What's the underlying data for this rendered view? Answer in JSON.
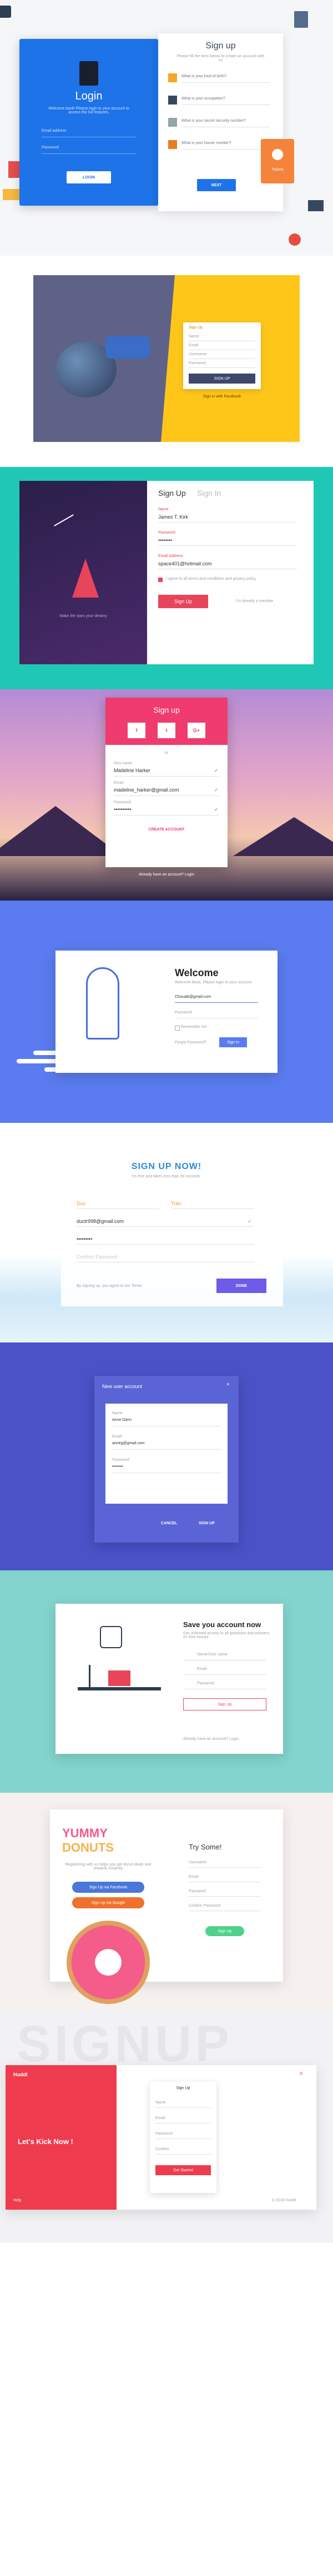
{
  "panel1": {
    "left_title": "Login",
    "left_desc": "Welcome back! Please login to your account to access the full features.",
    "email_placeholder": "Email address",
    "password_placeholder": "Password",
    "login_button": "LOGIN",
    "right_title": "Sign up",
    "right_desc": "Please fill the form below to create an account with us",
    "questions": [
      "What is your kind of birth?",
      "What is your occupation?",
      "What is your secret security number?",
      "What is your house number?"
    ],
    "next_button": "NEXT",
    "badge_text": "Tickets"
  },
  "panel2": {
    "card_title": "Sign Up",
    "fields": [
      "Name",
      "Email",
      "Username",
      "Password"
    ],
    "button": "SIGN UP",
    "footer": "Sign in with Facebook"
  },
  "panel3": {
    "left_text": "Make the stars your destiny",
    "tab_signup": "Sign Up",
    "tab_signin": "Sign In",
    "name_label": "Name",
    "name_value": "James T. Kirk",
    "password_label": "Password",
    "password_value": "••••••••",
    "email_label": "Email Address",
    "email_value": "space401@hotmail.com",
    "checkbox_text": "I agree to all terms and conditions and privacy policy",
    "button": "Sign Up",
    "link": "I'm already a member"
  },
  "panel4": {
    "title": "Sign up",
    "social": [
      "f",
      "t",
      "G+"
    ],
    "or_text": "or",
    "first_label": "First name",
    "first_value": "Madeline Harker",
    "email_label": "Email",
    "email_value": "madeline_harker@gmail.com",
    "password_label": "Password",
    "password_value": "••••••••••",
    "button": "CREATE ACCOUNT",
    "footer": "Already have an account? Login"
  },
  "panel5": {
    "title": "Welcome",
    "subtitle": "Welcome Back, Please login to your account",
    "email_value": "Chouaib@gmail.com",
    "password_placeholder": "Password",
    "remember": "Remember me",
    "forgot": "Forgot Password?",
    "button": "Sign In"
  },
  "panel6": {
    "title": "SIGN UP NOW!",
    "subtitle": "It's free and takes less than 30 seconds.",
    "first_name": "Duc",
    "last_name": "Tran",
    "email_value": "ductr998@gmail.com",
    "password_value": "•••••••••",
    "confirm_placeholder": "Confirm Password",
    "terms": "By signing up, you agree to our Terms",
    "button": "DONE"
  },
  "panel7": {
    "header": "New user account",
    "name_label": "Name",
    "name_value": "Anne Dann",
    "email_label": "Email",
    "email_value": "anneg@gmail.com",
    "password_label": "Password",
    "password_value": "••••••••",
    "cancel": "CANCEL",
    "signup": "SIGN UP"
  },
  "panel8": {
    "title": "Save you account now",
    "subtitle": "Get unlimited access to all questions and answers, it's free forever",
    "fields": [
      "Name/User name",
      "Email",
      "Password"
    ],
    "button": "Sign Up",
    "footer": "Already have an account? Login"
  },
  "panel9": {
    "brand_top": "YUMMY",
    "brand_bottom": "DONUTS",
    "desc": "Registering with us helps you get donut deals and rewards instantly",
    "facebook_button": "Sign Up via Facebook",
    "google_button": "Sign Up via Google",
    "right_title": "Try Some!",
    "fields": [
      "Username",
      "Email",
      "Password",
      "Confirm Password"
    ],
    "button": "Sign Up"
  },
  "panel10": {
    "bg_text": "SIGNUP",
    "brand": "Huddl",
    "tagline": "Let's Kick Now !",
    "card_title": "Sign Up",
    "fields": [
      "Name",
      "Email",
      "Password",
      "Confirm"
    ],
    "button": "Get Started",
    "footer_left": "Help",
    "footer_right": "© 2018 Huddl"
  },
  "colors": {
    "blue": "#1e73e8",
    "yellow": "#ffc61a",
    "teal": "#1fc8b4",
    "pink": "#e8445a",
    "donut_pink": "#f45c8a",
    "red": "#ef3b4e"
  }
}
